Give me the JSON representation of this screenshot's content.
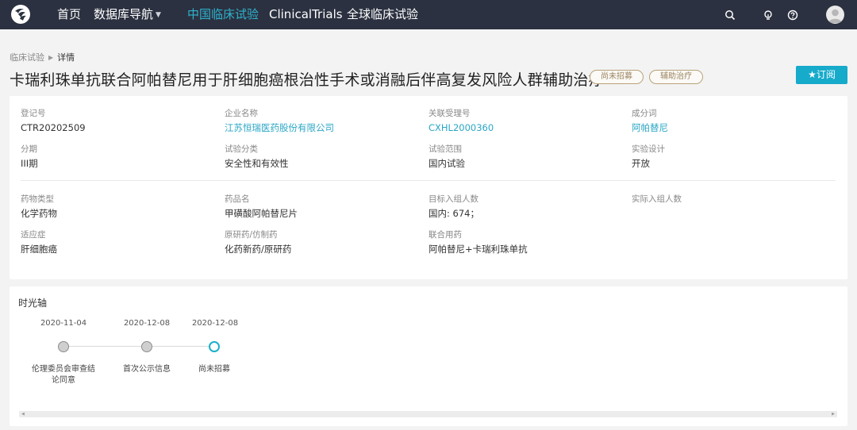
{
  "nav": {
    "items": [
      {
        "label": "首页"
      },
      {
        "label": "数据库导航"
      },
      {
        "label": "中国临床试验"
      },
      {
        "label": "ClinicalTrials"
      },
      {
        "label": "全球临床试验"
      }
    ],
    "active_color": "#2fb3cf",
    "bar_color": "#2b3140",
    "icons": [
      "search-icon",
      "lightbulb-icon",
      "help-icon",
      "user-avatar"
    ]
  },
  "breadcrumb": {
    "parent": "临床试验",
    "current": "详情"
  },
  "title": "卡瑞利珠单抗联合阿帕替尼用于肝细胞癌根治性手术或消融后伴高复发风险人群辅助治疗",
  "tags": [
    "尚未招募",
    "辅助治疗"
  ],
  "subscribe": {
    "icon": "star-icon",
    "label": "★订阅"
  },
  "info": {
    "reg_no": {
      "label": "登记号",
      "value": "CTR20202509"
    },
    "company": {
      "label": "企业名称",
      "value": "江苏恒瑞医药股份有限公司"
    },
    "accept_no": {
      "label": "关联受理号",
      "value": "CXHL2000360"
    },
    "ingredient": {
      "label": "成分词",
      "value": "阿帕替尼"
    },
    "phase": {
      "label": "分期",
      "value": "III期"
    },
    "trial_type": {
      "label": "试验分类",
      "value": "安全性和有效性"
    },
    "scope": {
      "label": "试验范围",
      "value": "国内试验"
    },
    "design": {
      "label": "实验设计",
      "value": "开放"
    },
    "drug_type": {
      "label": "药物类型",
      "value": "化学药物"
    },
    "drug_name": {
      "label": "药品名",
      "value": "甲磺酸阿帕替尼片"
    },
    "target_enroll": {
      "label": "目标入组人数",
      "value": "国内: 674；"
    },
    "actual_enroll": {
      "label": "实际入组人数",
      "value": ""
    },
    "indication": {
      "label": "适应症",
      "value": "肝细胞癌"
    },
    "original": {
      "label": "原研药/仿制药",
      "value": "化药新药/原研药"
    },
    "combo": {
      "label": "联合用药",
      "value": "阿帕替尼+卡瑞利珠单抗"
    }
  },
  "timeline": {
    "title": "时光轴",
    "events": [
      {
        "date": "2020-11-04",
        "label": "伦理委员会审查结论同意",
        "status": "done"
      },
      {
        "date": "2020-12-08",
        "label": "首次公示信息",
        "status": "done"
      },
      {
        "date": "2020-12-08",
        "label": "尚未招募",
        "status": "current"
      }
    ]
  }
}
